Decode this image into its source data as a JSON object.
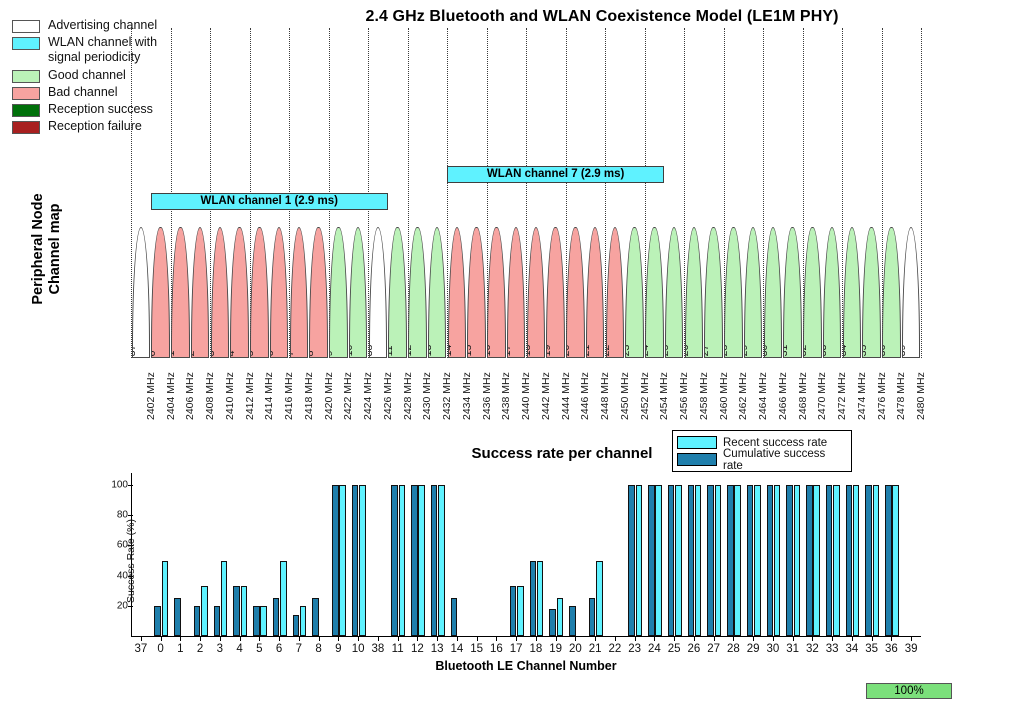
{
  "title": "2.4 GHz Bluetooth and WLAN Coexistence Model (LE1M PHY)",
  "map_legend": {
    "items": [
      {
        "label": "Advertising channel",
        "color": "#ffffff"
      },
      {
        "label": "WLAN channel with\nsignal periodicity",
        "color": "#5FF2FF"
      },
      {
        "label": "Good channel",
        "color": "#BBF2B8"
      },
      {
        "label": "Bad channel",
        "color": "#F7A3A0"
      },
      {
        "label": "Reception success",
        "color": "#00700A"
      },
      {
        "label": "Reception failure",
        "color": "#A82020"
      }
    ]
  },
  "channel_map": {
    "ylabel": "Peripheral Node\nChannel map",
    "wlan_bars": [
      {
        "label": "WLAN channel 1 (2.9 ms)",
        "start_index": 1,
        "end_index": 12,
        "row": 1
      },
      {
        "label": "WLAN channel 7 (2.9 ms)",
        "start_index": 16,
        "end_index": 26,
        "row": 0
      }
    ],
    "channels": [
      {
        "label": "Channel-37",
        "state": "advertising",
        "freq": "2402 MHz"
      },
      {
        "label": "Channel-0",
        "state": "bad",
        "freq": "2404 MHz"
      },
      {
        "label": "Channel-1",
        "state": "bad",
        "freq": "2406 MHz"
      },
      {
        "label": "Channel-2",
        "state": "bad",
        "freq": "2408 MHz"
      },
      {
        "label": "Channel-3",
        "state": "bad",
        "freq": "2410 MHz"
      },
      {
        "label": "Channel-4",
        "state": "bad",
        "freq": "2412 MHz"
      },
      {
        "label": "Channel-5",
        "state": "bad",
        "freq": "2414 MHz"
      },
      {
        "label": "Channel-6",
        "state": "bad",
        "freq": "2416 MHz"
      },
      {
        "label": "Channel-7",
        "state": "bad",
        "freq": "2418 MHz"
      },
      {
        "label": "Channel-8",
        "state": "bad",
        "freq": "2420 MHz"
      },
      {
        "label": "Channel-9",
        "state": "good",
        "freq": "2422 MHz"
      },
      {
        "label": "Channel-10",
        "state": "good",
        "freq": "2424 MHz"
      },
      {
        "label": "Channel-38",
        "state": "advertising",
        "freq": "2426 MHz"
      },
      {
        "label": "Channel-11",
        "state": "good",
        "freq": "2428 MHz"
      },
      {
        "label": "Channel-12",
        "state": "good",
        "freq": "2430 MHz"
      },
      {
        "label": "Channel-13",
        "state": "good",
        "freq": "2432 MHz"
      },
      {
        "label": "Channel-14",
        "state": "bad",
        "freq": "2434 MHz"
      },
      {
        "label": "Channel-15",
        "state": "bad",
        "freq": "2436 MHz"
      },
      {
        "label": "Channel-16",
        "state": "bad",
        "freq": "2438 MHz"
      },
      {
        "label": "Channel-17",
        "state": "bad",
        "freq": "2440 MHz"
      },
      {
        "label": "Channel-18",
        "state": "bad",
        "freq": "2442 MHz"
      },
      {
        "label": "Channel-19",
        "state": "bad",
        "freq": "2444 MHz"
      },
      {
        "label": "Channel-20",
        "state": "bad",
        "freq": "2446 MHz"
      },
      {
        "label": "Channel-21",
        "state": "bad",
        "freq": "2448 MHz"
      },
      {
        "label": "Channel-22",
        "state": "bad",
        "freq": "2450 MHz"
      },
      {
        "label": "Channel-23",
        "state": "good",
        "freq": "2452 MHz"
      },
      {
        "label": "Channel-24",
        "state": "good",
        "freq": "2454 MHz"
      },
      {
        "label": "Channel-25",
        "state": "good",
        "freq": "2456 MHz"
      },
      {
        "label": "Channel-26",
        "state": "good",
        "freq": "2458 MHz"
      },
      {
        "label": "Channel-27",
        "state": "good",
        "freq": "2460 MHz"
      },
      {
        "label": "Channel-28",
        "state": "good",
        "freq": "2462 MHz"
      },
      {
        "label": "Channel-29",
        "state": "good",
        "freq": "2464 MHz"
      },
      {
        "label": "Channel-30",
        "state": "good",
        "freq": "2466 MHz"
      },
      {
        "label": "Channel-31",
        "state": "good",
        "freq": "2468 MHz"
      },
      {
        "label": "Channel-32",
        "state": "good",
        "freq": "2470 MHz"
      },
      {
        "label": "Channel-33",
        "state": "good",
        "freq": "2472 MHz"
      },
      {
        "label": "Channel-34",
        "state": "good",
        "freq": "2474 MHz"
      },
      {
        "label": "Channel-35",
        "state": "good",
        "freq": "2476 MHz"
      },
      {
        "label": "Channel-36",
        "state": "good",
        "freq": "2478 MHz"
      },
      {
        "label": "Channel-39",
        "state": "advertising",
        "freq": "2480 MHz"
      }
    ]
  },
  "success_legend": {
    "items": [
      {
        "label": "Recent success rate",
        "color": "#5FF2FF"
      },
      {
        "label": "Cumulative success rate",
        "color": "#1F7FAC"
      }
    ]
  },
  "progress": {
    "label": "100%",
    "color": "#7BE07B"
  },
  "chart_data": {
    "type": "bar",
    "title": "Success rate per channel",
    "xlabel": "Bluetooth LE Channel Number",
    "ylabel": "Success Rate (%)",
    "ylim": [
      0,
      108
    ],
    "yticks": [
      20,
      40,
      60,
      80,
      100
    ],
    "grid": false,
    "legend_position": "top-right",
    "categories": [
      "37",
      "0",
      "1",
      "2",
      "3",
      "4",
      "5",
      "6",
      "7",
      "8",
      "9",
      "10",
      "38",
      "11",
      "12",
      "13",
      "14",
      "15",
      "16",
      "17",
      "18",
      "19",
      "20",
      "21",
      "22",
      "23",
      "24",
      "25",
      "26",
      "27",
      "28",
      "29",
      "30",
      "31",
      "32",
      "33",
      "34",
      "35",
      "36",
      "39"
    ],
    "series": [
      {
        "name": "Cumulative success rate",
        "color": "#1F7FAC",
        "values": [
          0,
          20,
          25,
          20,
          20,
          33,
          20,
          25,
          14,
          25,
          100,
          100,
          0,
          100,
          100,
          100,
          25,
          0,
          0,
          33,
          50,
          18,
          20,
          25,
          0,
          100,
          100,
          100,
          100,
          100,
          100,
          100,
          100,
          100,
          100,
          100,
          100,
          100,
          100,
          0
        ]
      },
      {
        "name": "Recent success rate",
        "color": "#5FF2FF",
        "values": [
          0,
          50,
          0,
          33,
          50,
          33,
          20,
          50,
          20,
          0,
          100,
          100,
          0,
          100,
          100,
          100,
          0,
          0,
          0,
          33,
          50,
          25,
          0,
          50,
          0,
          100,
          100,
          100,
          100,
          100,
          100,
          100,
          100,
          100,
          100,
          100,
          100,
          100,
          100,
          0
        ]
      }
    ]
  }
}
